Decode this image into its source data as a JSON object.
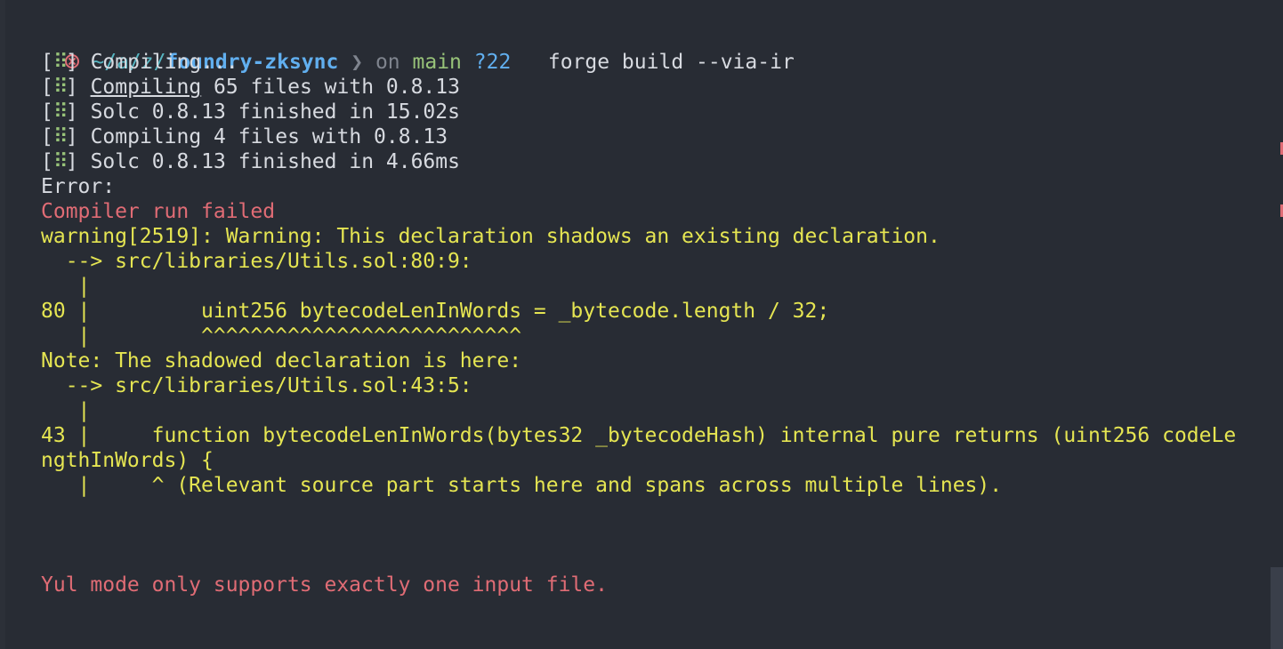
{
  "prompt": {
    "status_icon": "error-circle-icon",
    "path_prefix": "~/a/z/",
    "path_dir": "foundry-zksync",
    "separator": "❯",
    "on_text": "on",
    "branch": "main",
    "git_status": "?22",
    "command": "forge build --via-ir"
  },
  "progress": [
    {
      "spinner": "⠿",
      "lead": "",
      "underlined": "",
      "text": "Compiling..."
    },
    {
      "spinner": "⠿",
      "lead": "",
      "underlined": "Compiling",
      "text": " 65 files with 0.8.13"
    },
    {
      "spinner": "⠿",
      "lead": "",
      "underlined": "",
      "text": "Solc 0.8.13 finished in 15.02s"
    },
    {
      "spinner": "⠿",
      "lead": "",
      "underlined": "",
      "text": "Compiling 4 files with 0.8.13"
    },
    {
      "spinner": "⠿",
      "lead": "",
      "underlined": "",
      "text": "Solc 0.8.13 finished in 4.66ms"
    }
  ],
  "output": {
    "error_label": "Error:",
    "compiler_failed": "Compiler run failed",
    "warning_header": "warning[2519]: Warning: This declaration shadows an existing declaration.",
    "warning_location": "  --> src/libraries/Utils.sol:80:9:",
    "gutter_empty_1": "   |",
    "code_line_80": "80 |         uint256 bytecodeLenInWords = _bytecode.length / 32;",
    "code_marker_80": "   |         ^^^^^^^^^^^^^^^^^^^^^^^^^^",
    "note_header": "Note: The shadowed declaration is here:",
    "note_location": "  --> src/libraries/Utils.sol:43:5:",
    "gutter_empty_2": "   |",
    "code_line_43a": "43 |     function bytecodeLenInWords(bytes32 _bytecodeHash) internal pure returns (uint256 codeLe",
    "code_line_43b": "ngthInWords) {",
    "code_marker_43": "   |     ^ (Relevant source part starts here and spans across multiple lines).",
    "yul_error": "Yul mode only supports exactly one input file."
  },
  "colors": {
    "background": "#282c34",
    "warning": "#e5e552",
    "error": "#e06c75",
    "path": "#61afef",
    "branch": "#98c379"
  }
}
